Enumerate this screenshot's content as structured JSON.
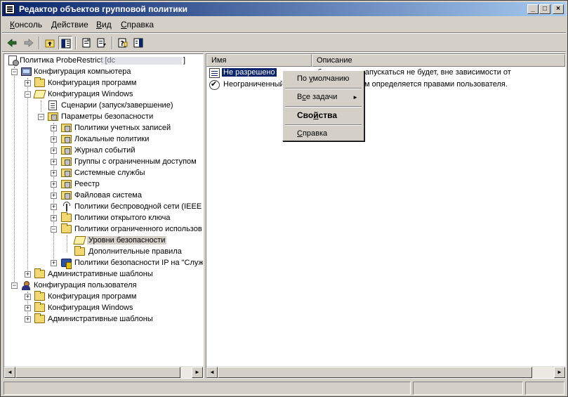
{
  "window": {
    "title": "Редактор объектов групповой политики",
    "controls": {
      "minimize": "_",
      "maximize": "□",
      "close": "×"
    }
  },
  "menu": [
    {
      "label": "Консоль",
      "accel": "К"
    },
    {
      "label": "Действие",
      "accel": "Д"
    },
    {
      "label": "Вид",
      "accel": "В"
    },
    {
      "label": "Справка",
      "accel": "С"
    }
  ],
  "toolbar": {
    "icons": [
      "back-arrow-icon",
      "forward-arrow-icon",
      "up-folder-icon",
      "show-hide-tree-icon",
      "properties-icon",
      "export-list-icon",
      "help-icon",
      "show-action-pane-icon"
    ]
  },
  "tree": {
    "root": "Политика ProbeRestrict [dc",
    "root_suffix": "]",
    "computer_config": "Конфигурация компьютера",
    "comp_software": "Конфигурация программ",
    "comp_windows": "Конфигурация Windows",
    "scripts": "Сценарии (запуск/завершение)",
    "security_settings": "Параметры безопасности",
    "account_policies": "Политики учетных записей",
    "local_policies": "Локальные политики",
    "event_log": "Журнал событий",
    "restricted_groups": "Группы с ограниченным доступом",
    "system_services": "Системные службы",
    "registry": "Реестр",
    "file_system": "Файловая система",
    "wireless": "Политики беспроводной сети (IEEE",
    "public_key": "Политики открытого ключа",
    "software_restriction": "Политики ограниченного использов",
    "security_levels": "Уровни безопасности",
    "additional_rules": "Дополнительные правила",
    "ip_security": "Политики безопасности IP на \"Служ",
    "comp_admin_templates": "Административные шаблоны",
    "user_config": "Конфигурация пользователя",
    "user_software": "Конфигурация программ",
    "user_windows": "Конфигурация Windows",
    "user_admin_templates": "Административные шаблоны",
    "expand_plus": "+",
    "expand_minus": "−"
  },
  "list": {
    "columns": [
      "Имя",
      "Описание"
    ],
    "rows": [
      {
        "name": "Не разрешено",
        "desc": "обеспечение запускаться не будет, вне зависимости от",
        "icon": "disallowed-icon"
      },
      {
        "name": "Неограниченный",
        "desc": "амм к ресурсам определяется правами пользователя.",
        "icon": "unrestricted-icon"
      }
    ]
  },
  "context_menu": {
    "items": [
      {
        "label": "По умолчанию",
        "accel": "у"
      },
      {
        "label": "Все задачи",
        "accel": "с",
        "submenu": "►"
      },
      {
        "label": "Свойства",
        "accel": "й",
        "bold": true
      },
      {
        "label": "Справка",
        "accel": "С"
      }
    ]
  },
  "scrollbars": {
    "left_arrow": "◄",
    "right_arrow": "►"
  },
  "colors": {
    "titlebar_start": "#0a246a",
    "titlebar_end": "#a6caf0",
    "selection": "#0a246a",
    "face": "#d4d0c8"
  }
}
